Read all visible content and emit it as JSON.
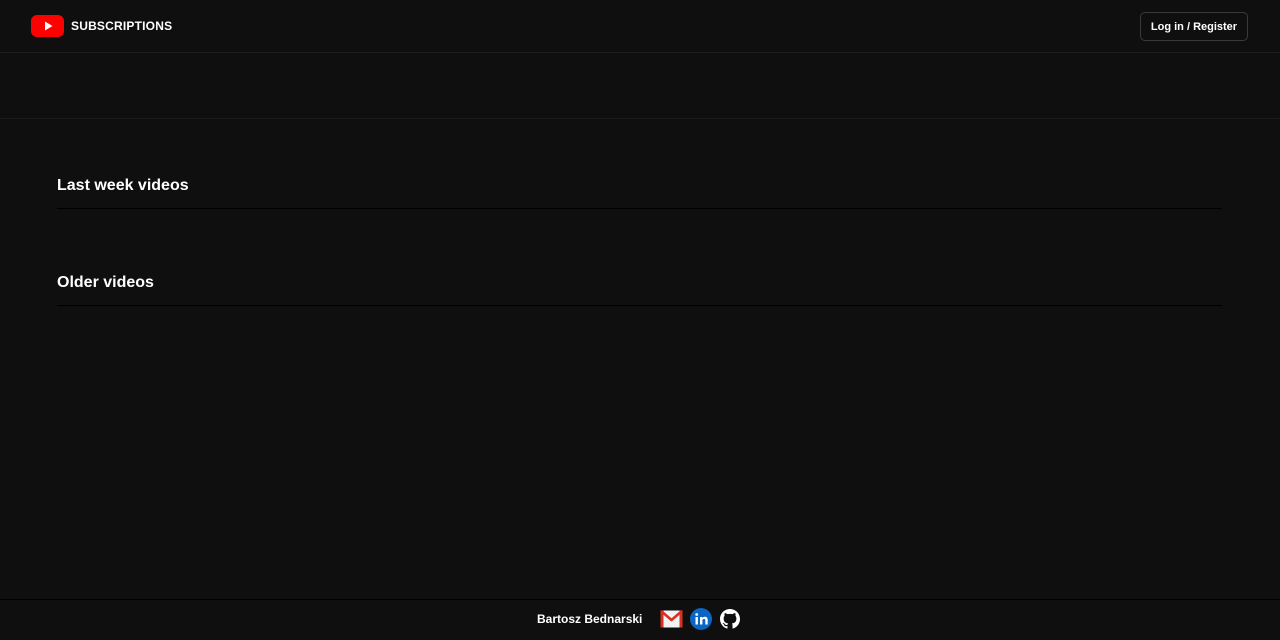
{
  "header": {
    "brand_title": "SUBSCRIPTIONS",
    "logo_icon": "youtube-play-icon",
    "login_label": "Log in / Register"
  },
  "main": {
    "sections": [
      {
        "title": "Last week videos"
      },
      {
        "title": "Older videos"
      }
    ]
  },
  "footer": {
    "author": "Bartosz Bednarski",
    "icons": [
      "gmail-icon",
      "linkedin-icon",
      "github-icon"
    ]
  },
  "colors": {
    "background": "#0f0f0f",
    "brand_red": "#ff0000",
    "linkedin_blue": "#0a66c2",
    "text": "#ffffff"
  }
}
